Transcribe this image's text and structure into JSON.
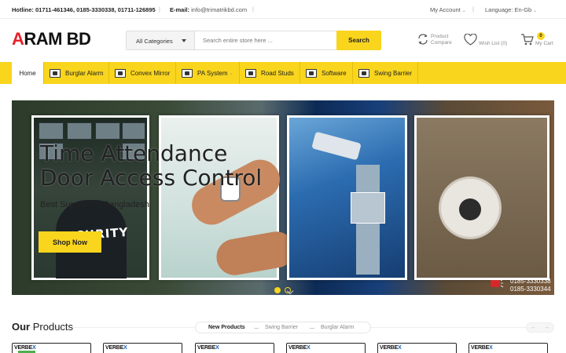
{
  "topbar": {
    "hotline_label": "Hotline:",
    "hotline_numbers": "01711-461346, 0185-3330338, 01711-126895",
    "email_label": "E-mail:",
    "email_value": "info@trimatrikbd.com",
    "account": "My Account",
    "language": "Language: En-Gb"
  },
  "logo": {
    "first": "A",
    "rest": "RAM BD"
  },
  "search": {
    "category": "All Categories",
    "placeholder": "Search entire store here ...",
    "button": "Search"
  },
  "header_actions": {
    "compare_line1": "Product",
    "compare_line2": "Compare",
    "wishlist": "Wish List (0)",
    "cart_count": "0",
    "cart_label": "My Cart"
  },
  "nav": [
    {
      "label": "Home"
    },
    {
      "label": "Burglar Alarm"
    },
    {
      "label": "Convex Mirror"
    },
    {
      "label": "PA System"
    },
    {
      "label": "Road Studs"
    },
    {
      "label": "Software"
    },
    {
      "label": "Swing Barrier"
    }
  ],
  "hero": {
    "title_line1": "Time Attendance",
    "title_line2": "Door Access Control",
    "subtitle": "Best Supplier In Bangladesh",
    "security_text": "SECURITY",
    "shop_button": "Shop Now",
    "phone1": "0185-3330338",
    "phone2": "0185-3330344",
    "slide_count": 2,
    "active_slide": 1
  },
  "products": {
    "heading_first": "Our",
    "heading_rest": " Products",
    "tabs": [
      "New Products",
      "Swing Barrier",
      "Burglar Alarm"
    ],
    "active_tab": 0,
    "prev": "←",
    "next": "→",
    "card_brand_a": "VERBE",
    "card_brand_b": "X"
  },
  "colors": {
    "accent": "#f9d51d",
    "logo_red": "#e8202a"
  },
  "icons": [
    "compare-icon",
    "heart-icon",
    "cart-icon",
    "phone-icon"
  ]
}
